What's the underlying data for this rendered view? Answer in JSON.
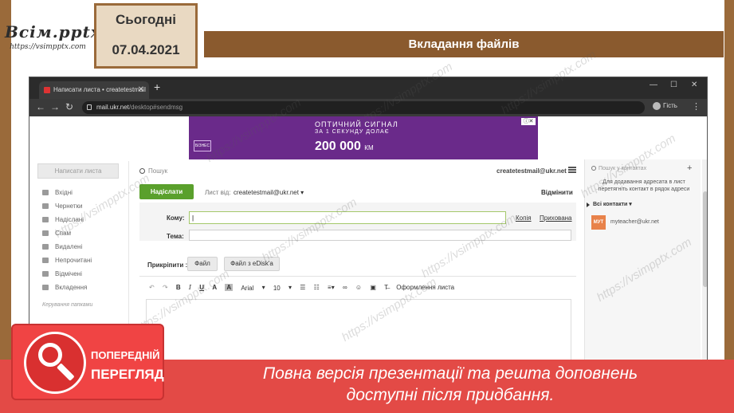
{
  "slide": {
    "logo_title": "Всім.pptx",
    "logo_url": "https://vsimpptx.com",
    "date_label": "Сьогодні",
    "date_value": "07.04.2021",
    "title": "Вкладання файлів",
    "watermark": "https://vsimpptx.com"
  },
  "browser": {
    "tab_title": "Написати листа • createtestmail",
    "address_host": "mail.ukr.net",
    "address_path": "/desktop#sendmsg",
    "guest_label": "Гість"
  },
  "banner": {
    "line1": "ОПТИЧНИЙ СИГНАЛ",
    "line2": "ЗА 1 СЕКУНДУ ДОЛАЄ",
    "value": "200 000",
    "unit": "КМ",
    "brand": "БІЗНЕС"
  },
  "mail": {
    "compose_label": "Написати листа",
    "folders": [
      "Вхідні",
      "Чернетки",
      "Надіслані",
      "Спам",
      "Видалені",
      "Непрочитані",
      "Відмічені",
      "Вкладення"
    ],
    "manage_folders": "Керування папками",
    "search_placeholder": "Пошук",
    "account": "createtestmail@ukr.net",
    "send_label": "Надіслати",
    "from_label": "Лист від:",
    "from_value": "createtestmail@ukr.net",
    "cancel_label": "Відмінити",
    "to_label": "Кому:",
    "to_value": "|",
    "copy_label": "Копія",
    "bcc_label": "Прихована",
    "subject_label": "Тема:",
    "attach_label": "Прикріпити :",
    "attach_file": "Файл",
    "attach_edisk": "Файл з eDisk'a",
    "format_font": "Arial",
    "format_size": "10",
    "format_styles": "Оформлення листа"
  },
  "contacts": {
    "search_placeholder": "Пошук у контактах",
    "hint": "Для додавання адресата в лист перетягніть контакт в рядок адреси",
    "all_label": "Всі контакти",
    "items": [
      {
        "initials": "МУТ",
        "email": "myteacher@ukr.net"
      }
    ]
  },
  "preview": {
    "badge_line1": "ПОПЕРЕДНІЙ",
    "badge_line2": "ПЕРЕГЛЯД",
    "text_line1": "Повна версія презентації та решта доповнень",
    "text_line2": "доступні після придбання."
  },
  "colors": {
    "brand_brown": "#8a5a2e",
    "send_green": "#5aa02c",
    "overlay_red": "#e34a46",
    "banner_purple": "#6a2a8a"
  }
}
